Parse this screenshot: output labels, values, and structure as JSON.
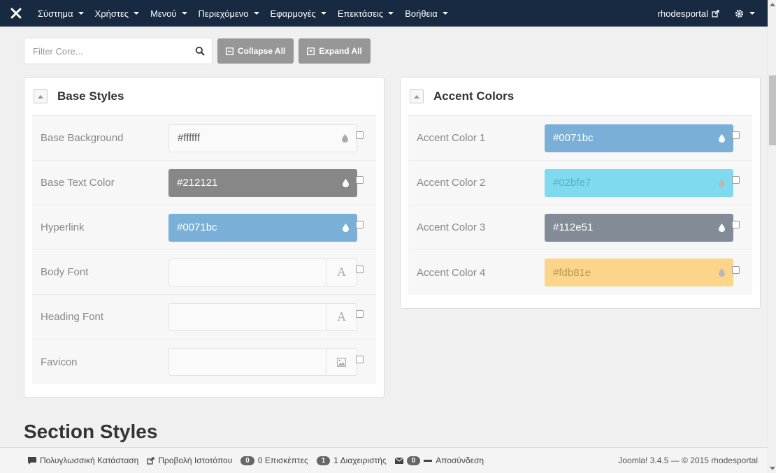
{
  "navbar": {
    "logo": "joomla-logo-icon",
    "menus": [
      "Σύστημα",
      "Χρήστες",
      "Μενού",
      "Περιεχόμενο",
      "Εφαρμογές",
      "Επεκτάσεις",
      "Βοήθεια"
    ],
    "site_link": "rhodesportal",
    "bg": "#172a42"
  },
  "toolbar": {
    "filter_placeholder": "Filter Core...",
    "collapse_label": "Collapse All",
    "expand_label": "Expand All"
  },
  "base_styles": {
    "title": "Base Styles",
    "rows": [
      {
        "label": "Base Background",
        "value": "#ffffff",
        "type": "color",
        "swatch": null,
        "icon": "drop-icon"
      },
      {
        "label": "Base Text Color",
        "value": "#212121",
        "type": "color",
        "swatch": "#878787",
        "icon": "drop-icon"
      },
      {
        "label": "Hyperlink",
        "value": "#0071bc",
        "type": "color",
        "swatch": "#7ab0d8",
        "icon": "drop-icon"
      },
      {
        "label": "Body Font",
        "value": "",
        "type": "font",
        "swatch": null,
        "icon": "font-icon",
        "glyph": "A"
      },
      {
        "label": "Heading Font",
        "value": "",
        "type": "font",
        "swatch": null,
        "icon": "font-icon",
        "glyph": "A"
      },
      {
        "label": "Favicon",
        "value": "",
        "type": "image",
        "swatch": null,
        "icon": "image-icon"
      }
    ]
  },
  "accent_colors": {
    "title": "Accent Colors",
    "rows": [
      {
        "label": "Accent Color 1",
        "value": "#0071bc",
        "type": "color",
        "swatch": "#7ab0d8",
        "icon": "drop-icon"
      },
      {
        "label": "Accent Color 2",
        "value": "#02bfe7",
        "type": "color",
        "swatch": "#7fdaf0",
        "icon": "drop-icon"
      },
      {
        "label": "Accent Color 3",
        "value": "#112e51",
        "type": "color",
        "swatch": "#838c96",
        "icon": "drop-icon"
      },
      {
        "label": "Accent Color 4",
        "value": "#fdb81e",
        "type": "color",
        "swatch": "#fbd58a",
        "icon": "drop-icon"
      }
    ]
  },
  "section_title": "Section Styles",
  "footer": {
    "multilang": "Πολυγλωσσική Κατάσταση",
    "view_site": "Προβολή Ιστοτόπου",
    "visitors_count": "0",
    "visitors": "0 Επισκέπτες",
    "admins_count": "1",
    "admins": "1 Διαχειριστής",
    "messages_count": "0",
    "logout": "Αποσύνδεση",
    "version": "Joomla! 3.4.5 — © 2015 rhodesportal"
  }
}
